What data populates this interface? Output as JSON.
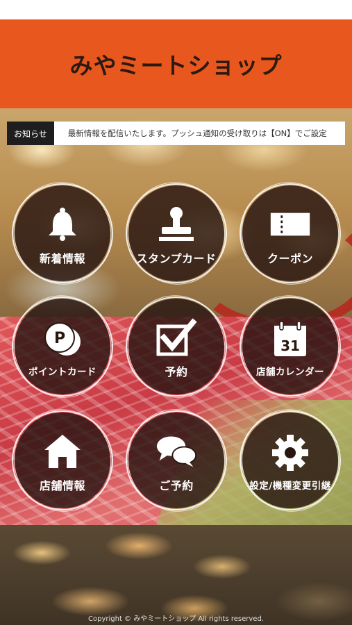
{
  "app": {
    "title": "みやミートショップ"
  },
  "notice": {
    "label": "お知らせ",
    "text": "最新情報を配信いたします。プッシュ通知の受け取りは【ON】でご設定"
  },
  "menu": [
    {
      "label": "新着情報",
      "icon": "bell-icon"
    },
    {
      "label": "スタンプカード",
      "icon": "stamp-icon"
    },
    {
      "label": "クーポン",
      "icon": "ticket-icon"
    },
    {
      "label": "ポイントカード",
      "icon": "coin-icon"
    },
    {
      "label": "予約",
      "icon": "checkbox-icon"
    },
    {
      "label": "店舗カレンダー",
      "icon": "calendar-icon",
      "calendar_day": "31"
    },
    {
      "label": "店舗情報",
      "icon": "house-icon"
    },
    {
      "label": "ご予約",
      "icon": "chat-bubbles-icon"
    },
    {
      "label": "設定/機種変更引継",
      "icon": "gear-icon"
    }
  ],
  "footer": {
    "copyright": "Copyright © みやミートショップ All rights reserved."
  },
  "colors": {
    "header": "#e8571e",
    "button_bg": "#28160f"
  }
}
